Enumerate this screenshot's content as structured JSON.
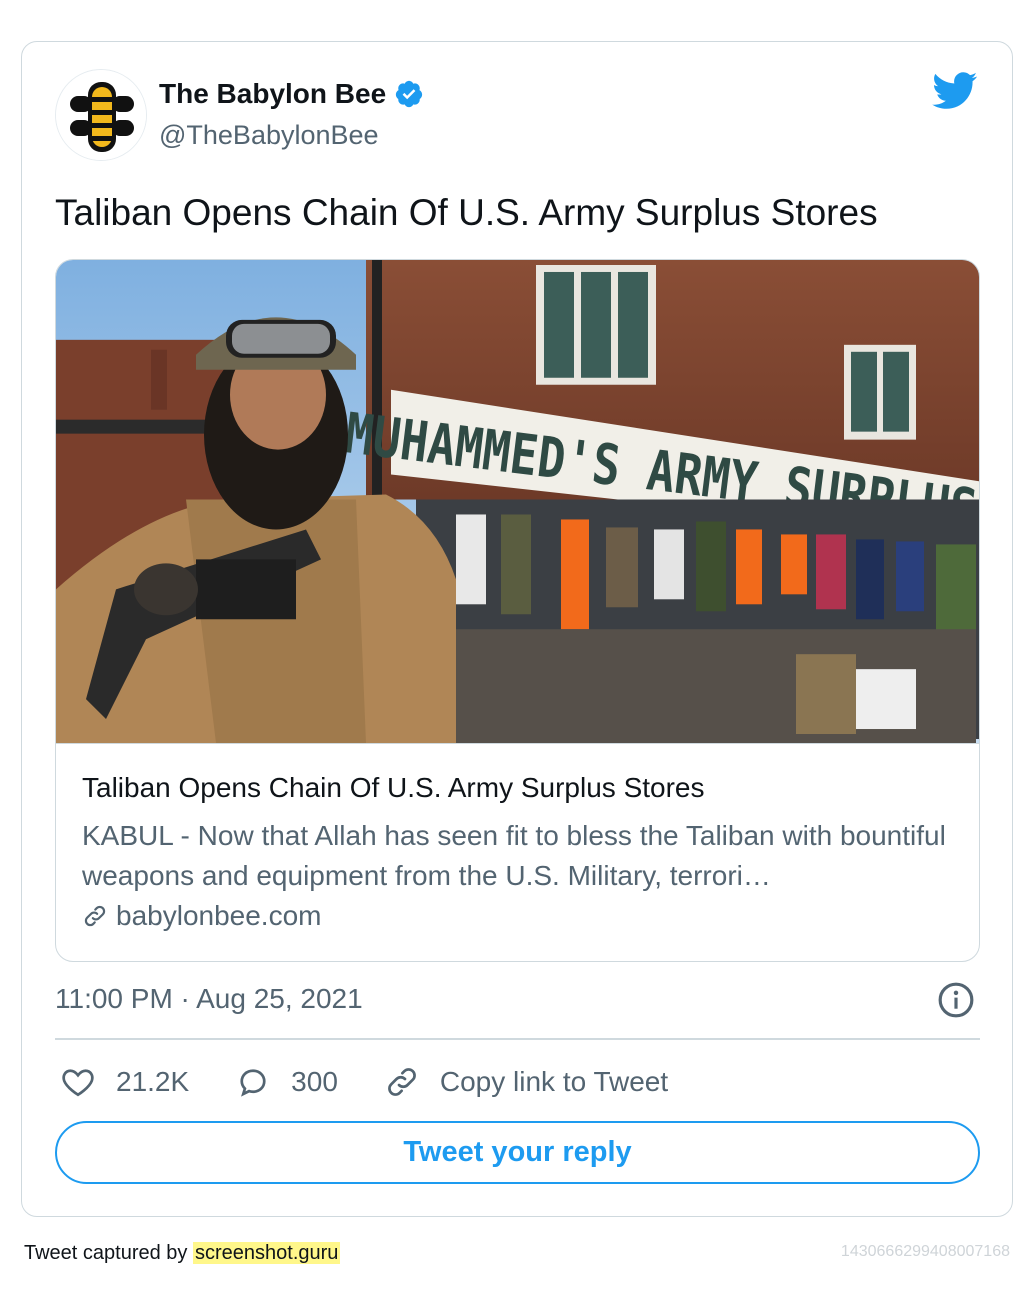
{
  "tweet": {
    "author_name": "The Babylon Bee",
    "handle": "@TheBabylonBee",
    "text": "Taliban Opens Chain Of U.S. Army Surplus Stores",
    "timestamp": "11:00 PM · Aug 25, 2021"
  },
  "link_card": {
    "image_sign_text": "MUHAMMED'S ARMY SURPLUS",
    "title": "Taliban Opens Chain Of U.S. Army Surplus Stores",
    "description": "KABUL - Now that Allah has seen fit to bless the Taliban with bountiful weapons and equipment from the U.S. Military, terrori…",
    "domain": "babylonbee.com"
  },
  "actions": {
    "likes": "21.2K",
    "replies": "300",
    "copy_link": "Copy link to Tweet"
  },
  "reply_button": "Tweet your reply",
  "footer": {
    "captured_prefix": "Tweet captured by ",
    "captured_site": "screenshot.guru",
    "tweet_id": "1430666299408007168"
  },
  "colors": {
    "twitter_blue": "#1d9bf0",
    "text_primary": "#0f1419",
    "text_secondary": "#536471",
    "border": "#cfd9de",
    "highlight": "#fff78a"
  },
  "icons": [
    "babylon-bee-logo-icon",
    "verified-badge-icon",
    "twitter-bird-icon",
    "link-icon",
    "info-icon",
    "heart-icon",
    "reply-bubble-icon",
    "copy-link-icon"
  ]
}
